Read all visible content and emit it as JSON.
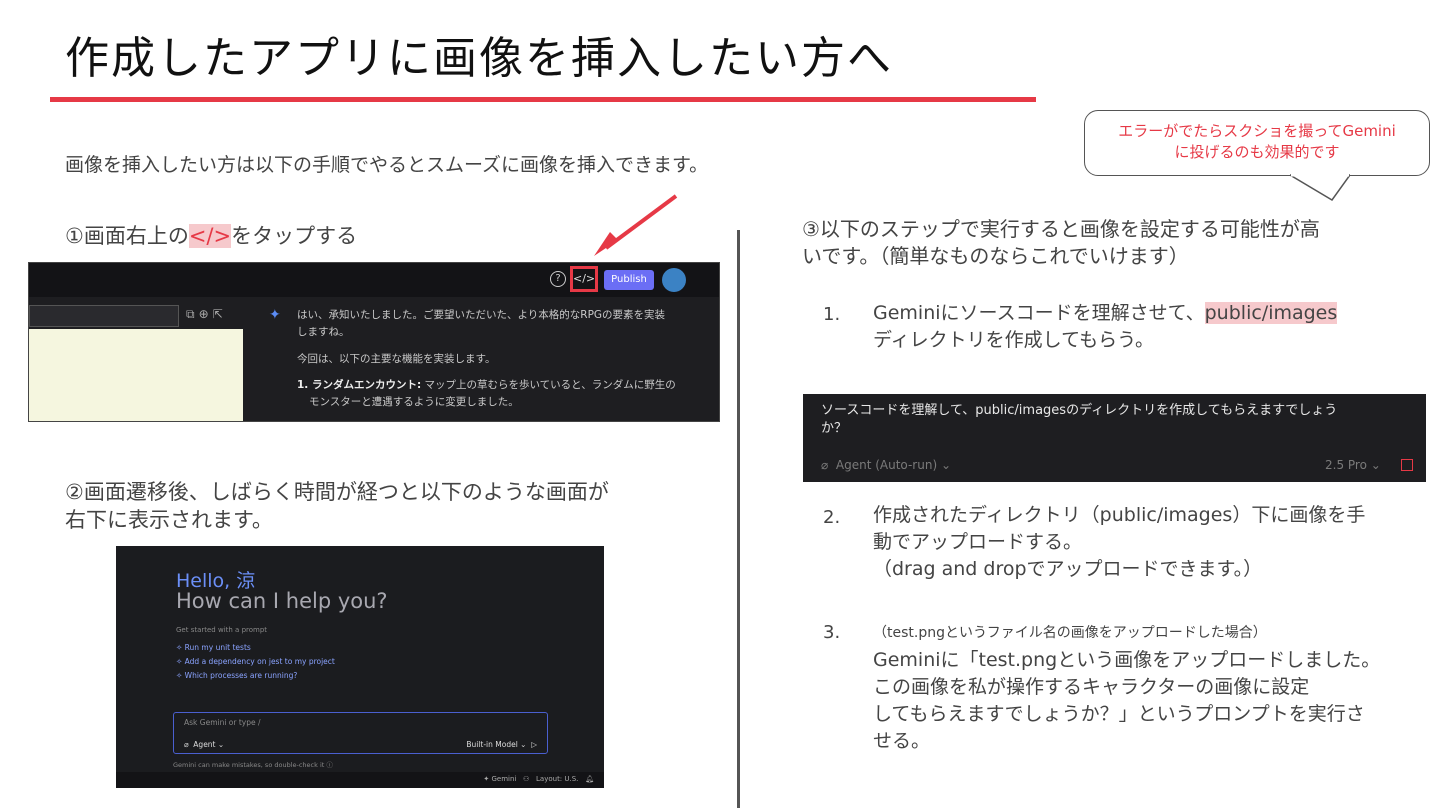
{
  "title": "作成したアプリに画像を挿入したい方へ",
  "intro": "画像を挿入したい方は以下の手順でやるとスムーズに画像を挿入できます。",
  "callout": {
    "line1": "エラーがでたらスクショを撮ってGemini",
    "line2": "に投げるのも効果的です"
  },
  "step1": {
    "prefix": "①画面右上の",
    "highlight": "</>",
    "suffix": "をタップする"
  },
  "shot1": {
    "help": "?",
    "code_button": "</>",
    "publish": "Publish",
    "line1": "はい、承知いたしました。ご要望いただいた、より本格的なRPGの要素を実装",
    "line2": "しますね。",
    "line3": "今回は、以下の主要な機能を実装します。",
    "line4_bold": "1. ランダムエンカウント:",
    "line4": " マップ上の草むらを歩いていると、ランダムに野生の",
    "line5": "モンスターと遭遇するように変更しました。"
  },
  "step2": {
    "line1": "②画面遷移後、しばらく時間が経つと以下のような画面が",
    "line2": "右下に表示されます。"
  },
  "shot2": {
    "hello": "Hello, 涼",
    "help": "How can I help you?",
    "get_started": "Get started with a prompt",
    "prompts": [
      "Run my unit tests",
      "Add a dependency on jest to my project",
      "Which processes are running?"
    ],
    "ask": "Ask Gemini or type /",
    "agent": "Agent",
    "model": "Built-in Model",
    "note": "Gemini can make mistakes, so double-check it",
    "gemini": "Gemini",
    "layout": "Layout: U.S."
  },
  "step3": {
    "line1": "③以下のステップで実行すると画像を設定する可能性が高",
    "line2": "いです。（簡単なものならこれでいけます）"
  },
  "items": [
    {
      "num": "1.",
      "prefix": "Geminiにソースコードを理解させて、",
      "highlight": "public/images",
      "line2": "ディレクトリを作成してもらう。"
    },
    {
      "num": "2.",
      "line1": "作成されたディレクトリ（public/images）下に画像を手",
      "line2": "動でアップロードする。",
      "line3": "（drag and dropでアップロードできます。）"
    },
    {
      "num": "3.",
      "note": "（test.pngというファイル名の画像をアップロードした場合）",
      "line1": "Geminiに「test.pngという画像をアップロードしました。",
      "line2": "この画像を私が操作するキャラクターの画像に設定",
      "line3": "してもらえますでしょうか？」というプロンプトを実行さ",
      "line4": "せる。"
    }
  ],
  "shot3": {
    "prompt_line1": "ソースコードを理解して、public/imagesのディレクトリを作成してもらえますでしょう",
    "prompt_line2": "か？",
    "agent": "Agent (Auto-run)",
    "model": "2.5 Pro"
  },
  "colors": {
    "accent": "#e63946",
    "highlight_bg": "#f6c9cc"
  }
}
